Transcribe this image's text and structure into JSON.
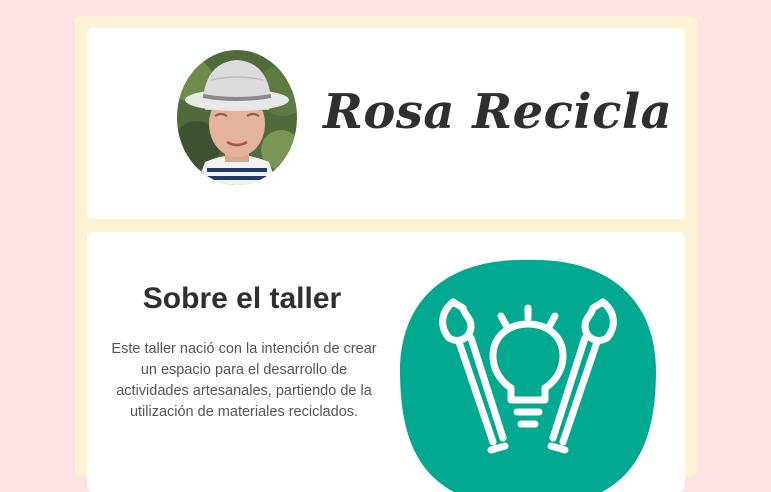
{
  "header": {
    "avatar_alt": "Foto de Rosa",
    "title": "Rosa Recicla"
  },
  "about": {
    "title": "Sobre el taller",
    "text": "Este taller nació con la intención de crear un espacio para el desarrollo de actividades artesanales, partiendo de la utilización de materiales reciclados.",
    "icon": "lightbulb-brushes-icon"
  },
  "colors": {
    "background": "#fde3e3",
    "frame": "#fdf2d3",
    "card": "#ffffff",
    "accent": "#00a98f",
    "heading": "#2f2f2f",
    "body_text": "#555555"
  }
}
